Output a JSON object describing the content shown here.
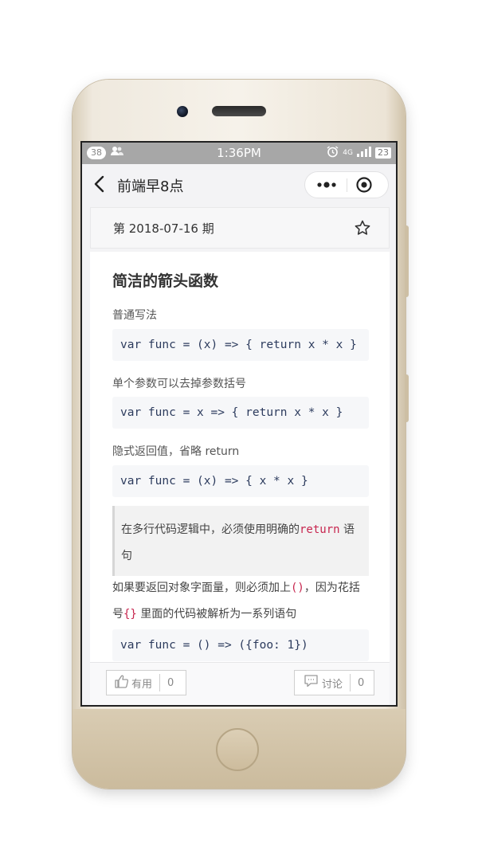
{
  "statusbar": {
    "notification_count": "38",
    "time": "1:36PM",
    "network": "4G",
    "battery": "23"
  },
  "navbar": {
    "title": "前端早8点"
  },
  "issue": {
    "label": "第 2018-07-16 期"
  },
  "article": {
    "title": "简洁的箭头函数",
    "sections": [
      {
        "heading": "普通写法",
        "code": "var func = (x) => { return x * x }"
      },
      {
        "heading": "单个参数可以去掉参数括号",
        "code": "var func = x => { return x * x }"
      },
      {
        "heading": "隐式返回值，省略 return",
        "code": "var func = (x) => { x * x }"
      }
    ],
    "quote": {
      "text_before": "在多行代码逻辑中，必须使用明确的",
      "keyword": "return",
      "text_after": " 语句"
    },
    "para": {
      "part1": "如果要返回对象字面量，则必须加上",
      "code1": "()",
      "part2": "，因为花括号",
      "code2": "{}",
      "part3": " 里面的代码被解析为一系列语句"
    },
    "last_code": "var func = () => ({foo: 1})"
  },
  "footer": {
    "like_label": "有用",
    "like_count": "0",
    "comment_label": "讨论",
    "comment_count": "0"
  }
}
